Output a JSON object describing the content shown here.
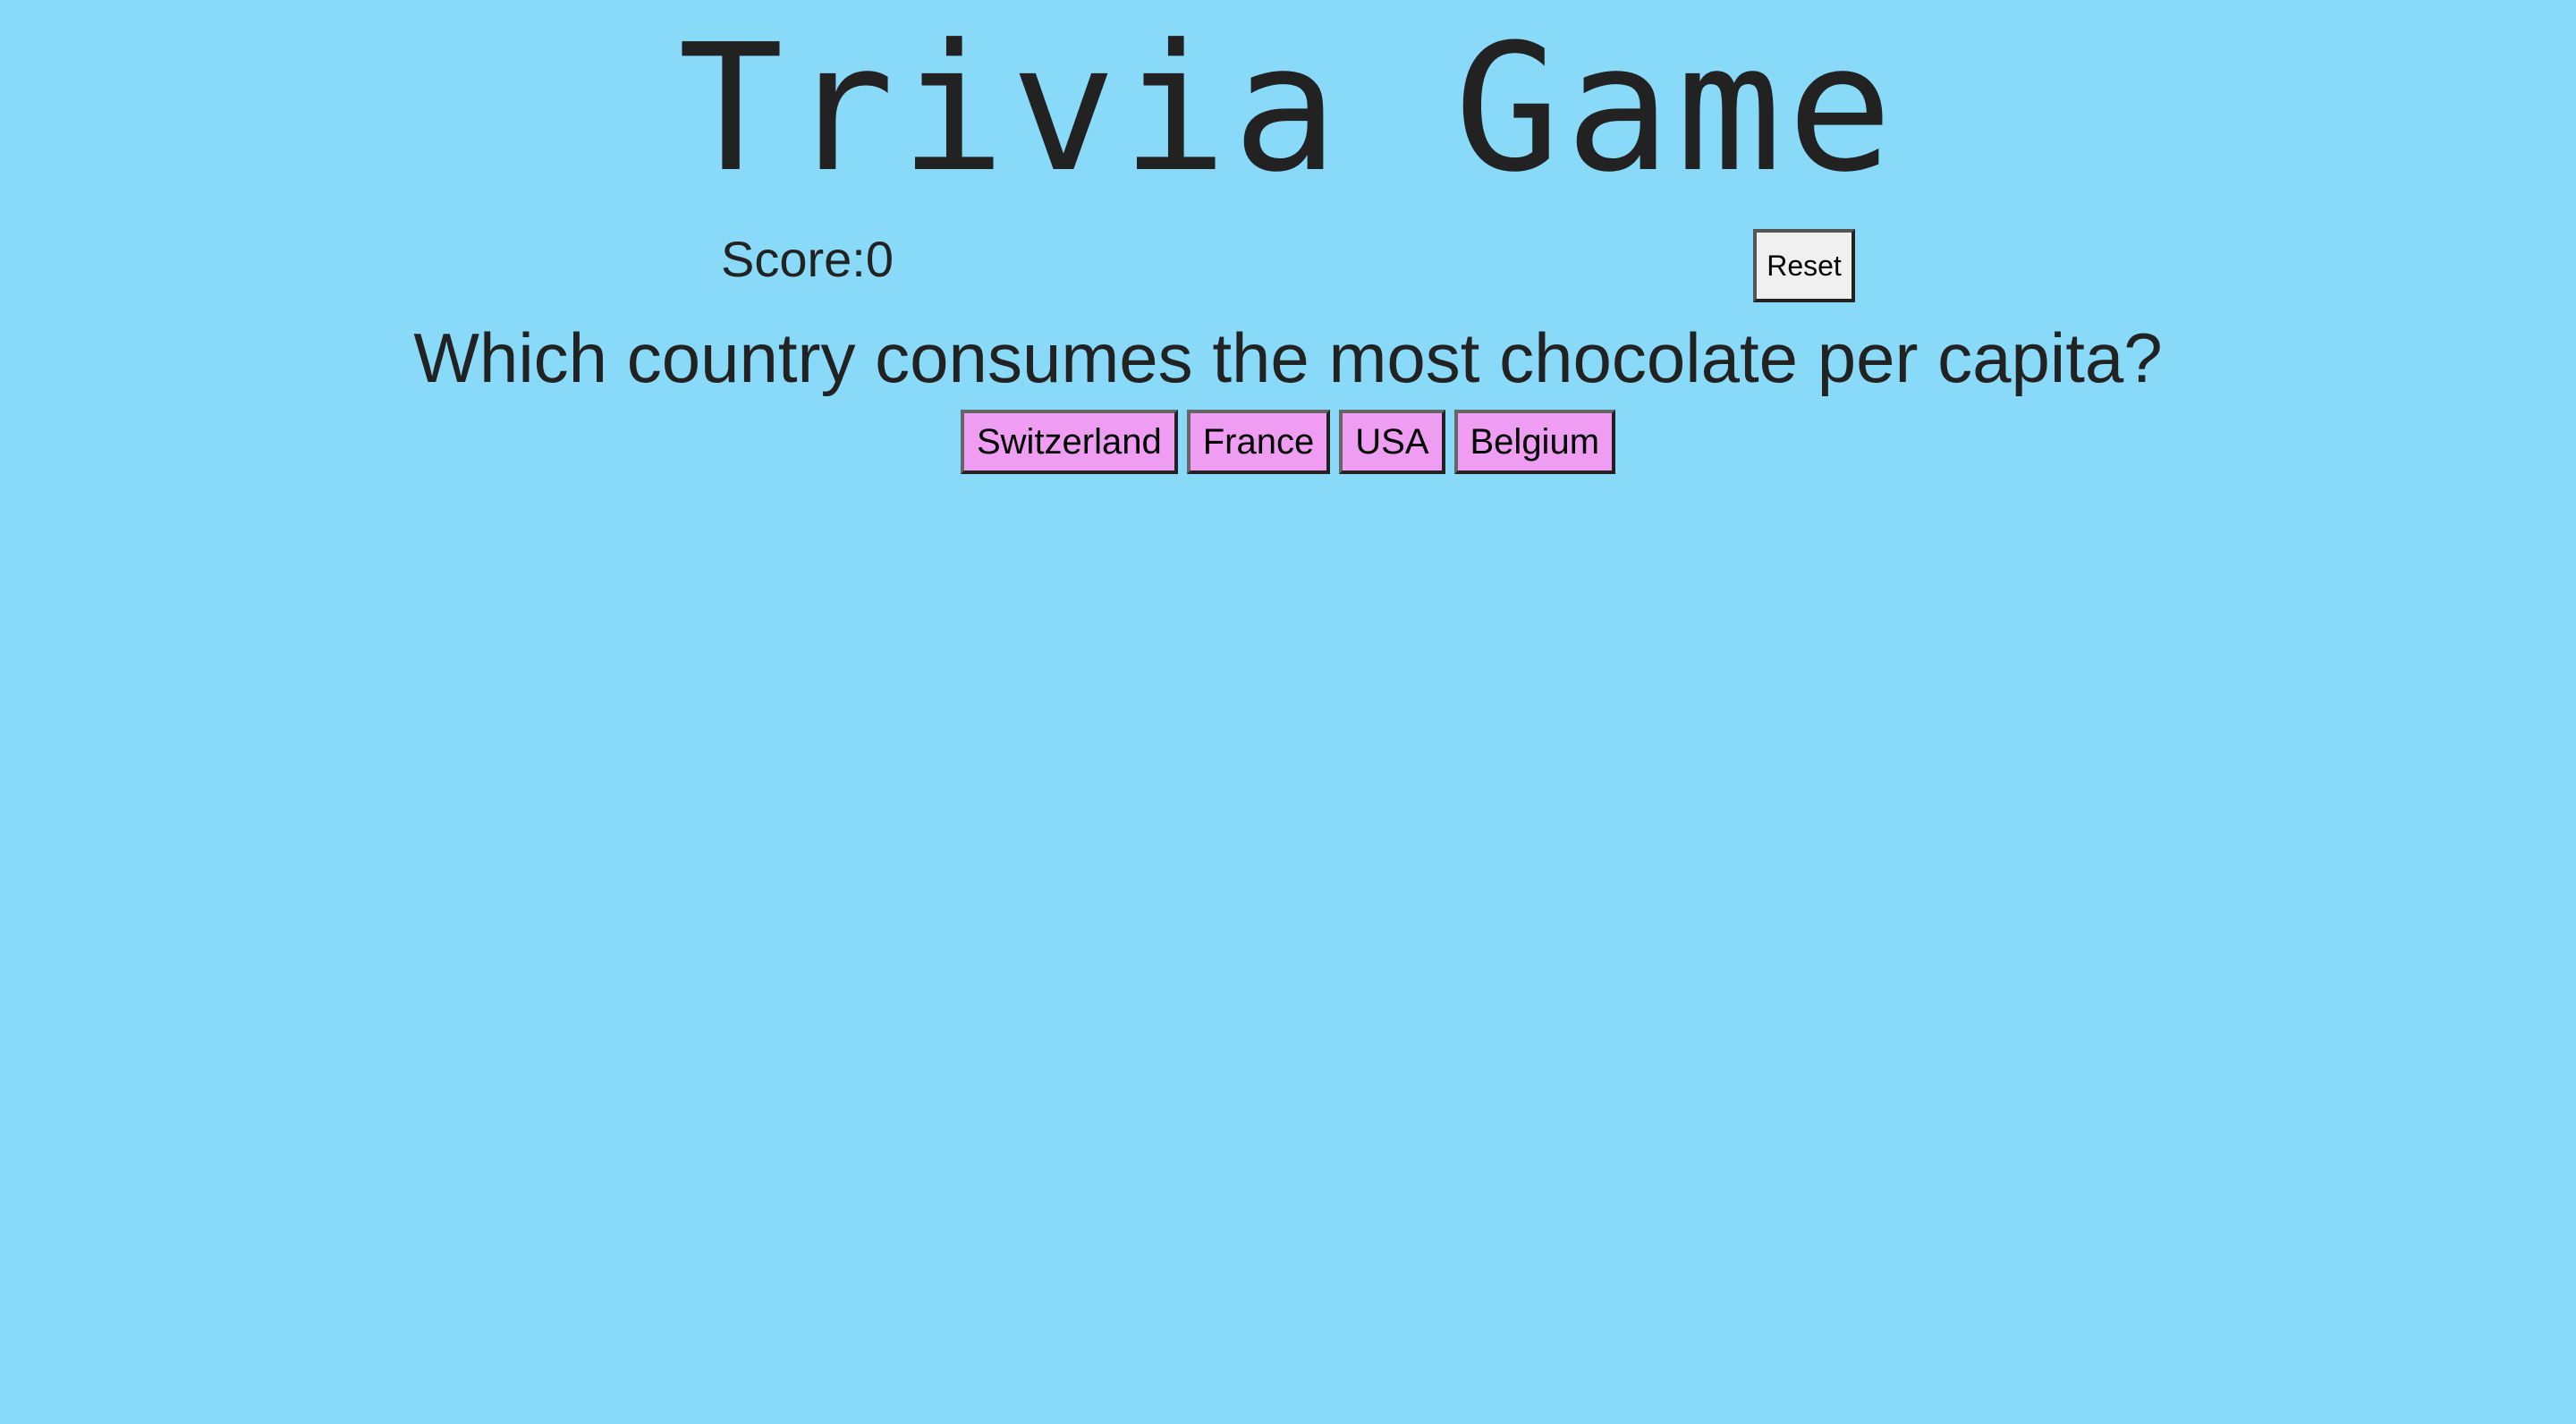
{
  "header": {
    "title": "Trivia Game"
  },
  "scoreboard": {
    "score_text": "Score:0",
    "reset_label": "Reset"
  },
  "quiz": {
    "question": "Which country consumes the most chocolate per capita?",
    "answers": [
      {
        "label": "Switzerland"
      },
      {
        "label": "France"
      },
      {
        "label": "USA"
      },
      {
        "label": "Belgium"
      }
    ]
  },
  "colors": {
    "background": "#89daf9",
    "answer_button": "#ee9df2",
    "reset_button": "#f0f0f0",
    "text": "#222222"
  }
}
